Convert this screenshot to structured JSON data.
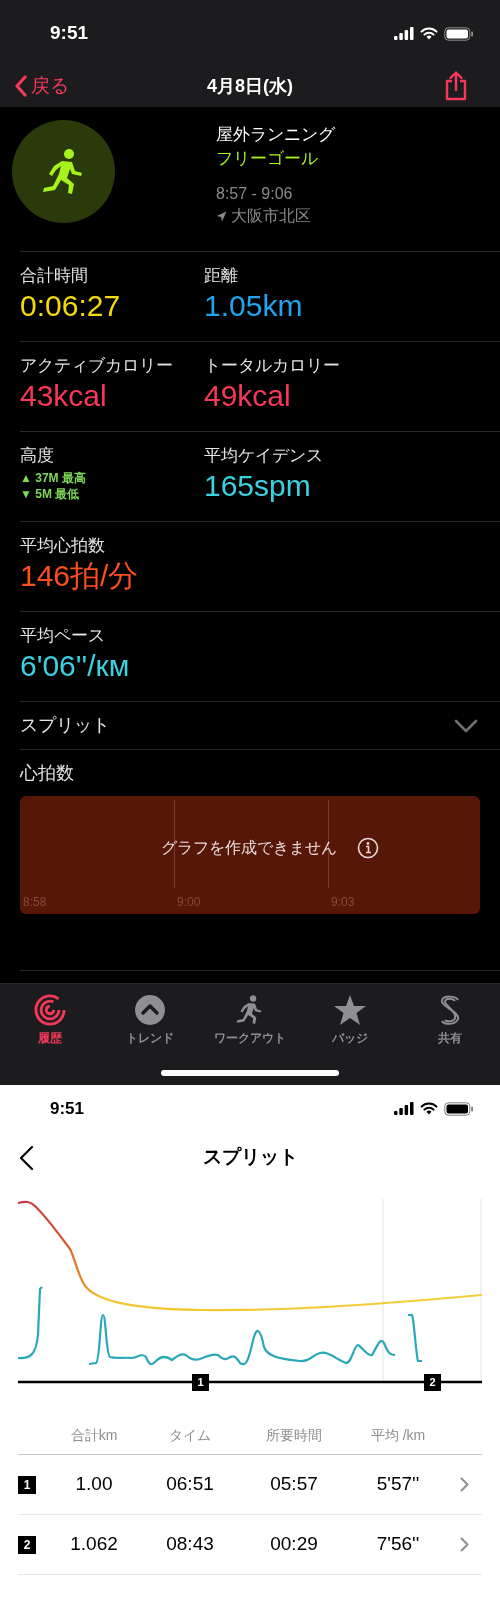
{
  "status_bar": {
    "time": "9:51"
  },
  "nav": {
    "back": "戻る",
    "title": "4月8日(水)"
  },
  "workout": {
    "type": "屋外ランニング",
    "goal": "フリーゴール",
    "time_range": "8:57 - 9:06",
    "location": "大阪市北区"
  },
  "stats": [
    {
      "cells": [
        {
          "kind": "value",
          "label": "合計時間",
          "value": "0:06:27",
          "color": "#f5d90a"
        },
        {
          "kind": "value",
          "label": "距離",
          "value": "1.05km",
          "color": "#1fa5f0"
        }
      ]
    },
    {
      "cells": [
        {
          "kind": "value",
          "label": "アクティブカロリー",
          "value": "43kcal",
          "color": "#f5385a"
        },
        {
          "kind": "value",
          "label": "トータルカロリー",
          "value": "49kcal",
          "color": "#f5385a"
        }
      ]
    },
    {
      "cells": [
        {
          "kind": "range",
          "label": "高度",
          "lines": [
            "▲ 37M 最高",
            "▼ 5M 最低"
          ]
        },
        {
          "kind": "value",
          "label": "平均ケイデンス",
          "value": "165spm",
          "color": "#3ad2e0"
        }
      ]
    },
    {
      "cells": [
        {
          "kind": "value",
          "label": "平均心拍数",
          "value": "146拍/分",
          "color": "#fa4f1e"
        }
      ]
    },
    {
      "cells": [
        {
          "kind": "value",
          "label": "平均ペース",
          "value": "6'06''/км",
          "color": "#3ad2e0"
        }
      ]
    }
  ],
  "splits_row": {
    "label": "スプリット",
    "expanded": false
  },
  "heart_rate": {
    "title": "心拍数",
    "message": "グラフを作成できません",
    "times": [
      "8:58",
      "9:00",
      "9:03"
    ]
  },
  "tab_bar": [
    {
      "label": "履歴",
      "selected": true
    },
    {
      "label": "トレンド",
      "selected": false
    },
    {
      "label": "ワークアウト",
      "selected": false
    },
    {
      "label": "バッジ",
      "selected": false
    },
    {
      "label": "共有",
      "selected": false
    }
  ],
  "split_screen": {
    "status_time": "9:51",
    "title": "スプリット",
    "markers": [
      "1",
      "2"
    ],
    "columns": [
      "合計km",
      "タイム",
      "所要時間",
      "平均 /km"
    ],
    "rows": [
      {
        "index": "1",
        "cells": [
          "1.00",
          "06:51",
          "05:57",
          "5'57''"
        ]
      },
      {
        "index": "2",
        "cells": [
          "1.062",
          "08:43",
          "00:29",
          "7'56''"
        ]
      }
    ]
  }
}
